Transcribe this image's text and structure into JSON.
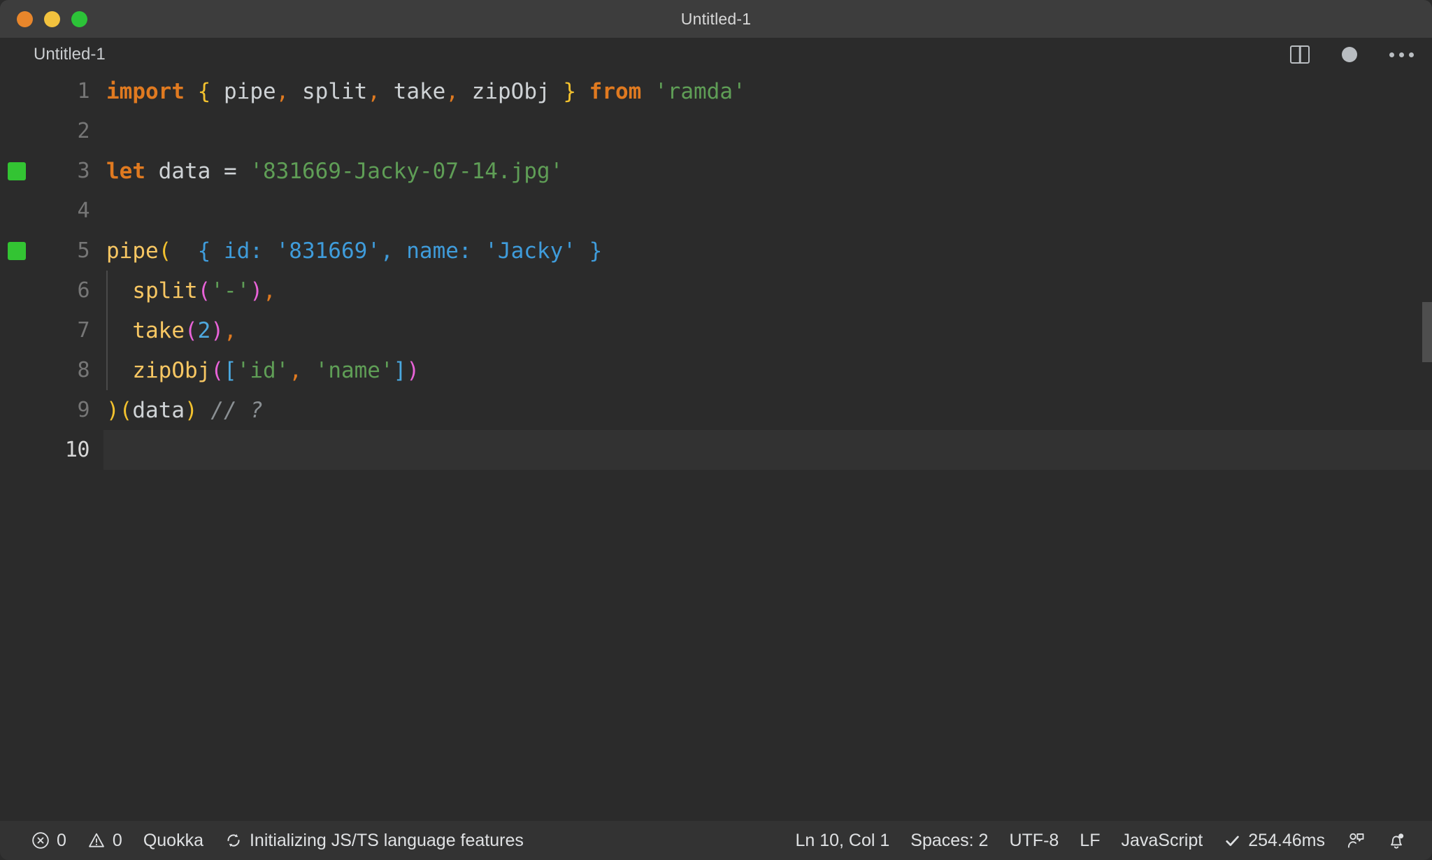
{
  "window": {
    "title": "Untitled-1",
    "traffic_lights": [
      {
        "name": "close",
        "color": "#e8862b"
      },
      {
        "name": "minimize",
        "color": "#f2c23e"
      },
      {
        "name": "maximize",
        "color": "#2cc338"
      }
    ]
  },
  "tabstrip": {
    "breadcrumb": "Untitled-1",
    "actions": [
      {
        "name": "split-editor-icon",
        "label": "Split Editor"
      },
      {
        "name": "unsaved-dot-icon",
        "label": "Unsaved changes"
      },
      {
        "name": "more-actions-icon",
        "label": "More Actions..."
      }
    ]
  },
  "editor": {
    "language": "JavaScript",
    "lines": [
      {
        "number": "1",
        "marker": false,
        "indent_guide": false,
        "current": false,
        "tokens": [
          {
            "t": "import",
            "c": "t-key"
          },
          {
            "t": " ",
            "c": "t-plain"
          },
          {
            "t": "{",
            "c": "b-yellow"
          },
          {
            "t": " ",
            "c": "t-plain"
          },
          {
            "t": "pipe",
            "c": "t-var"
          },
          {
            "t": ",",
            "c": "t-punc"
          },
          {
            "t": " ",
            "c": "t-plain"
          },
          {
            "t": "split",
            "c": "t-var"
          },
          {
            "t": ",",
            "c": "t-punc"
          },
          {
            "t": " ",
            "c": "t-plain"
          },
          {
            "t": "take",
            "c": "t-var"
          },
          {
            "t": ",",
            "c": "t-punc"
          },
          {
            "t": " ",
            "c": "t-plain"
          },
          {
            "t": "zipObj",
            "c": "t-var"
          },
          {
            "t": " ",
            "c": "t-plain"
          },
          {
            "t": "}",
            "c": "b-yellow"
          },
          {
            "t": " ",
            "c": "t-plain"
          },
          {
            "t": "from",
            "c": "t-key"
          },
          {
            "t": " ",
            "c": "t-plain"
          },
          {
            "t": "'ramda'",
            "c": "t-string"
          }
        ]
      },
      {
        "number": "2",
        "marker": false,
        "indent_guide": false,
        "current": false,
        "tokens": []
      },
      {
        "number": "3",
        "marker": true,
        "indent_guide": false,
        "current": false,
        "tokens": [
          {
            "t": "let",
            "c": "t-key"
          },
          {
            "t": " ",
            "c": "t-plain"
          },
          {
            "t": "data",
            "c": "t-var"
          },
          {
            "t": " = ",
            "c": "t-plain"
          },
          {
            "t": "'831669-Jacky-07-14.jpg'",
            "c": "t-string"
          }
        ]
      },
      {
        "number": "4",
        "marker": false,
        "indent_guide": false,
        "current": false,
        "tokens": []
      },
      {
        "number": "5",
        "marker": true,
        "indent_guide": false,
        "current": false,
        "tokens": [
          {
            "t": "pipe",
            "c": "t-fn"
          },
          {
            "t": "(",
            "c": "b-yellow"
          },
          {
            "t": "  { id: '831669', name: 'Jacky' }",
            "c": "t-result"
          }
        ]
      },
      {
        "number": "6",
        "marker": false,
        "indent_guide": true,
        "current": false,
        "tokens": [
          {
            "t": "  ",
            "c": "t-plain"
          },
          {
            "t": "split",
            "c": "t-fn"
          },
          {
            "t": "(",
            "c": "b-magenta"
          },
          {
            "t": "'-'",
            "c": "t-string"
          },
          {
            "t": ")",
            "c": "b-magenta"
          },
          {
            "t": ",",
            "c": "t-punc"
          }
        ]
      },
      {
        "number": "7",
        "marker": false,
        "indent_guide": true,
        "current": false,
        "tokens": [
          {
            "t": "  ",
            "c": "t-plain"
          },
          {
            "t": "take",
            "c": "t-fn"
          },
          {
            "t": "(",
            "c": "b-magenta"
          },
          {
            "t": "2",
            "c": "t-num"
          },
          {
            "t": ")",
            "c": "b-magenta"
          },
          {
            "t": ",",
            "c": "t-punc"
          }
        ]
      },
      {
        "number": "8",
        "marker": false,
        "indent_guide": true,
        "current": false,
        "tokens": [
          {
            "t": "  ",
            "c": "t-plain"
          },
          {
            "t": "zipObj",
            "c": "t-fn"
          },
          {
            "t": "(",
            "c": "b-magenta"
          },
          {
            "t": "[",
            "c": "b-blue"
          },
          {
            "t": "'id'",
            "c": "t-string"
          },
          {
            "t": ",",
            "c": "t-punc"
          },
          {
            "t": " ",
            "c": "t-plain"
          },
          {
            "t": "'name'",
            "c": "t-string"
          },
          {
            "t": "]",
            "c": "b-blue"
          },
          {
            "t": ")",
            "c": "b-magenta"
          }
        ]
      },
      {
        "number": "9",
        "marker": false,
        "indent_guide": false,
        "current": false,
        "tokens": [
          {
            "t": ")",
            "c": "b-yellow"
          },
          {
            "t": "(",
            "c": "b-yellow"
          },
          {
            "t": "data",
            "c": "t-var"
          },
          {
            "t": ")",
            "c": "b-yellow"
          },
          {
            "t": " ",
            "c": "t-plain"
          },
          {
            "t": "// ?",
            "c": "t-comment"
          }
        ]
      },
      {
        "number": "10",
        "marker": false,
        "indent_guide": false,
        "current": true,
        "tokens": []
      }
    ]
  },
  "statusbar": {
    "left": [
      {
        "name": "problems",
        "icon": "error-icon",
        "label": "0"
      },
      {
        "name": "problems-warn",
        "icon": "warning-icon",
        "label": "0"
      },
      {
        "name": "quokka",
        "icon": "",
        "label": "Quokka"
      },
      {
        "name": "language-status",
        "icon": "sync-icon",
        "label": "Initializing JS/TS language features"
      }
    ],
    "right": [
      {
        "name": "cursor-position",
        "icon": "",
        "label": "Ln 10, Col 1"
      },
      {
        "name": "indentation",
        "icon": "",
        "label": "Spaces: 2"
      },
      {
        "name": "encoding",
        "icon": "",
        "label": "UTF-8"
      },
      {
        "name": "eol",
        "icon": "",
        "label": "LF"
      },
      {
        "name": "language-mode",
        "icon": "",
        "label": "JavaScript"
      },
      {
        "name": "run-time",
        "icon": "check-icon",
        "label": "254.46ms"
      },
      {
        "name": "feedback",
        "icon": "feedback-icon",
        "label": ""
      },
      {
        "name": "notifications",
        "icon": "bell-icon",
        "label": ""
      }
    ]
  }
}
